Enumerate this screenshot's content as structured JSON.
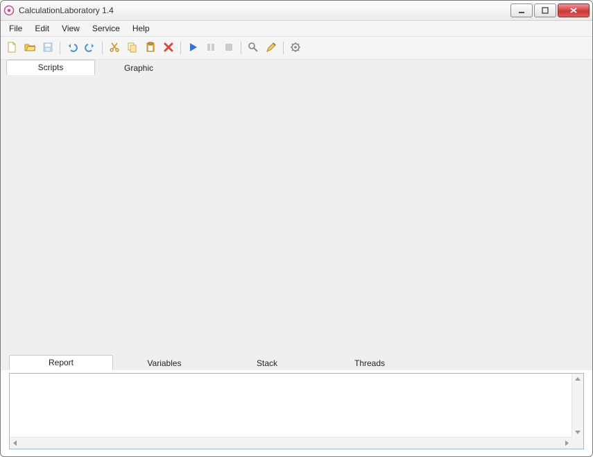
{
  "window": {
    "title": "CalculationLaboratory 1.4"
  },
  "menubar": {
    "items": [
      "File",
      "Edit",
      "View",
      "Service",
      "Help"
    ]
  },
  "toolbar": {
    "icons": [
      "new-file-icon",
      "open-file-icon",
      "save-icon",
      "sep",
      "undo-icon",
      "redo-icon",
      "sep",
      "cut-icon",
      "copy-icon",
      "paste-icon",
      "delete-icon",
      "sep",
      "run-icon",
      "pause-icon",
      "stop-icon",
      "sep",
      "find-icon",
      "edit-tool-icon",
      "sep",
      "settings-icon"
    ]
  },
  "upper_tabs": {
    "items": [
      {
        "label": "Scripts",
        "active": true
      },
      {
        "label": "Graphic",
        "active": false
      }
    ]
  },
  "lower_tabs": {
    "items": [
      {
        "label": "Report",
        "active": true
      },
      {
        "label": "Variables",
        "active": false
      },
      {
        "label": "Stack",
        "active": false
      },
      {
        "label": "Threads",
        "active": false
      }
    ]
  },
  "output": {
    "text": ""
  }
}
